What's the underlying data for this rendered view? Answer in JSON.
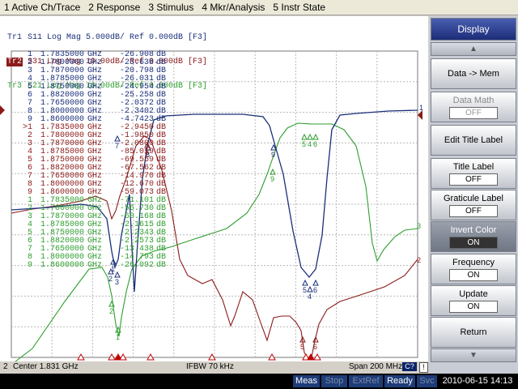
{
  "menu": [
    {
      "label": "1 Active Ch/Trace"
    },
    {
      "label": "2 Response"
    },
    {
      "label": "3 Stimulus"
    },
    {
      "label": "4 Mkr/Analysis"
    },
    {
      "label": "5 Instr State"
    }
  ],
  "traces_header": [
    {
      "name": "Tr1",
      "text": " S11 Log Mag 5.000dB/ Ref 0.000dB [F3]",
      "color": "#1a2f7a",
      "active": false
    },
    {
      "name": "Tr2",
      "text": " S31 Log Mag 10.00dB/ Ref 0.000dB [F3]",
      "color": "#8b1a1a",
      "active": true
    },
    {
      "name": "Tr3",
      "text": " S21 Log Mag 10.00dB/ Ref 0.000dB [F3]",
      "color": "#2e9e2e",
      "active": false
    }
  ],
  "markers": [
    {
      "num": "1",
      "freq": "1.7835000",
      "unit": "GHz",
      "value": "-26.908",
      "du": "dB",
      "color": "#1a2f7a"
    },
    {
      "num": "2",
      "freq": "1.7800000",
      "unit": "GHz",
      "value": "-23.638",
      "du": "dB",
      "color": "#1a2f7a"
    },
    {
      "num": "3",
      "freq": "1.7870000",
      "unit": "GHz",
      "value": "-20.798",
      "du": "dB",
      "color": "#1a2f7a"
    },
    {
      "num": "4",
      "freq": "1.8785000",
      "unit": "GHz",
      "value": "-26.031",
      "du": "dB",
      "color": "#1a2f7a"
    },
    {
      "num": "5",
      "freq": "1.8750000",
      "unit": "GHz",
      "value": "-24.954",
      "du": "dB",
      "color": "#1a2f7a"
    },
    {
      "num": "6",
      "freq": "1.8820000",
      "unit": "GHz",
      "value": "-25.258",
      "du": "dB",
      "color": "#1a2f7a"
    },
    {
      "num": "7",
      "freq": "1.7650000",
      "unit": "GHz",
      "value": "-2.0372",
      "du": "dB",
      "color": "#1a2f7a"
    },
    {
      "num": "8",
      "freq": "1.8000000",
      "unit": "GHz",
      "value": "-2.3402",
      "du": "dB",
      "color": "#1a2f7a"
    },
    {
      "num": "9",
      "freq": "1.8600000",
      "unit": "GHz",
      "value": "-4.7423",
      "du": "dB",
      "color": "#1a2f7a"
    },
    {
      "num": ">1",
      "freq": "1.7835000",
      "unit": "GHz",
      "value": "-2.9450",
      "du": "dB",
      "color": "#8b1a1a"
    },
    {
      "num": "2",
      "freq": "1.7800000",
      "unit": "GHz",
      "value": "-1.9850",
      "du": "dB",
      "color": "#8b1a1a"
    },
    {
      "num": "3",
      "freq": "1.7870000",
      "unit": "GHz",
      "value": "-2.0800",
      "du": "dB",
      "color": "#8b1a1a"
    },
    {
      "num": "4",
      "freq": "1.8785000",
      "unit": "GHz",
      "value": "-85.019",
      "du": "dB",
      "color": "#8b1a1a"
    },
    {
      "num": "5",
      "freq": "1.8750000",
      "unit": "GHz",
      "value": "-69.559",
      "du": "dB",
      "color": "#8b1a1a"
    },
    {
      "num": "6",
      "freq": "1.8820000",
      "unit": "GHz",
      "value": "-67.562",
      "du": "dB",
      "color": "#8b1a1a"
    },
    {
      "num": "7",
      "freq": "1.7650000",
      "unit": "GHz",
      "value": "-14.970",
      "du": "dB",
      "color": "#8b1a1a"
    },
    {
      "num": "8",
      "freq": "1.8000000",
      "unit": "GHz",
      "value": "-12.670",
      "du": "dB",
      "color": "#8b1a1a"
    },
    {
      "num": "9",
      "freq": "1.8600000",
      "unit": "GHz",
      "value": "-59.073",
      "du": "dB",
      "color": "#8b1a1a"
    },
    {
      "num": "1",
      "freq": "1.7835000",
      "unit": "GHz",
      "value": "-71.101",
      "du": "dB",
      "color": "#2e9e2e"
    },
    {
      "num": "2",
      "freq": "1.7800000",
      "unit": "GHz",
      "value": "-56.730",
      "du": "dB",
      "color": "#2e9e2e"
    },
    {
      "num": "3",
      "freq": "1.7870000",
      "unit": "GHz",
      "value": "-60.168",
      "du": "dB",
      "color": "#2e9e2e"
    },
    {
      "num": "4",
      "freq": "1.8785000",
      "unit": "GHz",
      "value": "-2.1615",
      "du": "dB",
      "color": "#2e9e2e"
    },
    {
      "num": "5",
      "freq": "1.8750000",
      "unit": "GHz",
      "value": "-2.2343",
      "du": "dB",
      "color": "#2e9e2e"
    },
    {
      "num": "6",
      "freq": "1.8820000",
      "unit": "GHz",
      "value": "-2.2573",
      "du": "dB",
      "color": "#2e9e2e"
    },
    {
      "num": "7",
      "freq": "1.7650000",
      "unit": "GHz",
      "value": "-13.438",
      "du": "dB",
      "color": "#2e9e2e"
    },
    {
      "num": "8",
      "freq": "1.8000000",
      "unit": "GHz",
      "value": "-14.793",
      "du": "dB",
      "color": "#2e9e2e"
    },
    {
      "num": "9",
      "freq": "1.8600000",
      "unit": "GHz",
      "value": "-26.092",
      "du": "dB",
      "color": "#2e9e2e"
    }
  ],
  "trace_end_labels": {
    "s11": "1",
    "s31": "2",
    "s21": "3"
  },
  "status": {
    "channel": "2",
    "center": "Center 1.831 GHz",
    "ifbw": "IFBW 70 kHz",
    "span": "Span 200 MHz",
    "c2": "C?",
    "excl": "!"
  },
  "bottom": {
    "meas": "Meas",
    "stop": "Stop",
    "extref": "ExtRef",
    "ready": "Ready",
    "svc": "Svc",
    "datetime": "2010-06-15 14:13"
  },
  "softkeys": {
    "title": "Display",
    "data_mem": "Data -> Mem",
    "data_math": "Data Math",
    "data_math_val": "OFF",
    "edit_title": "Edit Title Label",
    "title_label": "Title Label",
    "title_label_val": "OFF",
    "graticule_label": "Graticule Label",
    "graticule_label_val": "OFF",
    "invert_color": "Invert Color",
    "invert_color_val": "ON",
    "frequency": "Frequency",
    "frequency_val": "ON",
    "update": "Update",
    "update_val": "ON",
    "return": "Return"
  },
  "colors": {
    "s11": "#1a2f7a",
    "s31": "#8b1a1a",
    "s21": "#2e9e2e",
    "grid": "#b8b8b8"
  }
}
